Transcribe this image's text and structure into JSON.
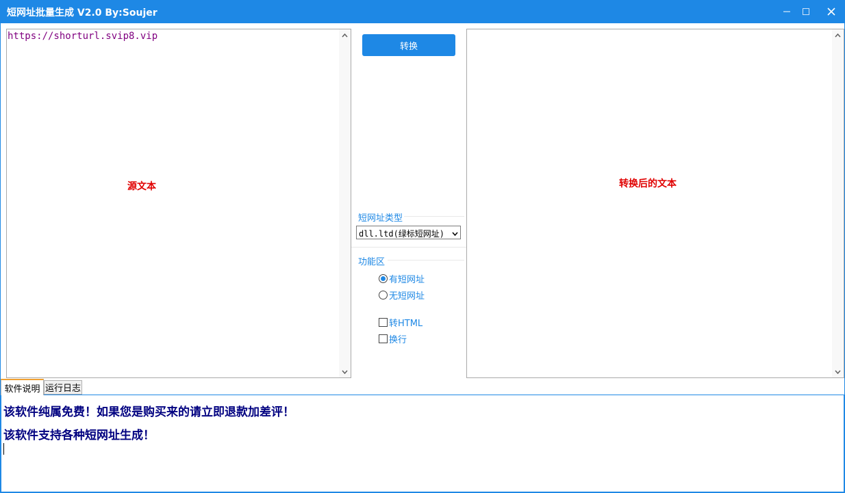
{
  "window": {
    "title": "短网址批量生成   V2.0 By:Soujer",
    "minimize": "—",
    "maximize": "▫",
    "close": "✕"
  },
  "source_pane": {
    "text": "https://shorturl.svip8.vip",
    "placeholder": "源文本"
  },
  "result_pane": {
    "text": "",
    "placeholder": "转换后的文本"
  },
  "controls": {
    "convert_label": "转换",
    "type_group_label": "短网址类型",
    "type_selected": "dll.ltd(绿标短网址)",
    "function_group_label": "功能区",
    "radio_with_short": "有短网址",
    "radio_without_short": "无短网址",
    "radio_with_short_checked": true,
    "check_to_html": "转HTML",
    "check_to_html_checked": false,
    "check_newline": "换行",
    "check_newline_checked": false
  },
  "tabs": [
    {
      "label": "软件说明",
      "active": true
    },
    {
      "label": "运行日志",
      "active": false
    }
  ],
  "info": {
    "line1": "该软件纯属免费！如果您是购买来的请立即退款加差评！",
    "line2": "该软件支持各种短网址生成！"
  },
  "colors": {
    "accent": "#1e88e5",
    "placeholder": "#e00000",
    "source_text": "#800080",
    "info_text": "#000080"
  },
  "icons": {
    "scroll_up": "chevron-up-icon",
    "scroll_down": "chevron-down-icon",
    "select_arrow": "chevron-down-icon"
  }
}
